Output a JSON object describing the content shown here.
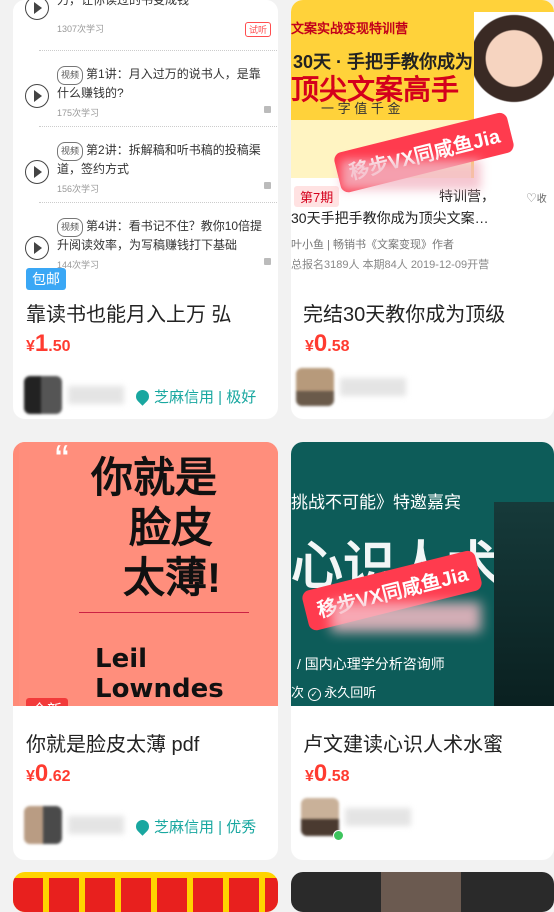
{
  "cards": [
    {
      "title": "靠读书也能月入上万 弘",
      "price": {
        "currency": "¥",
        "int": "1",
        "dec": ".50"
      },
      "tag": "包邮",
      "credit": "芝麻信用 | 极好",
      "lessons": [
        {
          "head": "力，让你读过的书变成钱",
          "count": "1307次学习",
          "badge": "试听"
        },
        {
          "vtag": "视频",
          "text": "第1讲：月入过万的说书人，是靠什么赚钱的?",
          "count": "175次学习"
        },
        {
          "vtag": "视频",
          "text": "第2讲：拆解稿和听书稿的投稿渠道，签约方式",
          "count": "156次学习"
        },
        {
          "vtag": "视频",
          "text": "第4讲：看书记不住？教你10倍提升阅读效率，为写稿赚钱打下基础",
          "count": "144次学习"
        }
      ]
    },
    {
      "title": "完结30天教你成为顶级",
      "price": {
        "currency": "¥",
        "int": "0",
        "dec": ".58"
      },
      "thumb": {
        "banner": "文案实战变现特训营",
        "headline1": "30天 · 手把手教你成为",
        "headline2": "顶尖文案高手",
        "sub": "一 字 值 千 金",
        "period": "第7期",
        "course_title": "30天手把手教你成为顶尖文案…",
        "course_tail": "特训营，",
        "author": "叶小鱼 | 畅销书《文案变现》作者",
        "stats": "总报名3189人  本期84人  2019-12-09开营",
        "fav": "收"
      },
      "watermark": "移步VX同咸鱼Jia"
    },
    {
      "title": "你就是脸皮太薄 pdf",
      "price": {
        "currency": "¥",
        "int": "0",
        "dec": ".62"
      },
      "tag": "全新",
      "credit": "芝麻信用 | 优秀",
      "book": {
        "title1": "你就是",
        "title2": "脸皮",
        "title3": "太薄!",
        "author": "Leil Lowndes"
      }
    },
    {
      "title": "卢文建读心识人术水蜜",
      "price": {
        "currency": "¥",
        "int": "0",
        "dec": ".58"
      },
      "thumb": {
        "line1": "挑战不可能》特邀嘉宾",
        "big": "心识人术",
        "role": "国内心理学分析咨询师",
        "replay": "永久回听",
        "replay_prefix": "次"
      },
      "watermark": "移步VX同咸鱼Jia"
    }
  ],
  "colors": {
    "price": "#ff3b30",
    "credit": "#19a7a0",
    "tag_blue": "#3aa7f5",
    "tag_red": "#f23a3a"
  }
}
